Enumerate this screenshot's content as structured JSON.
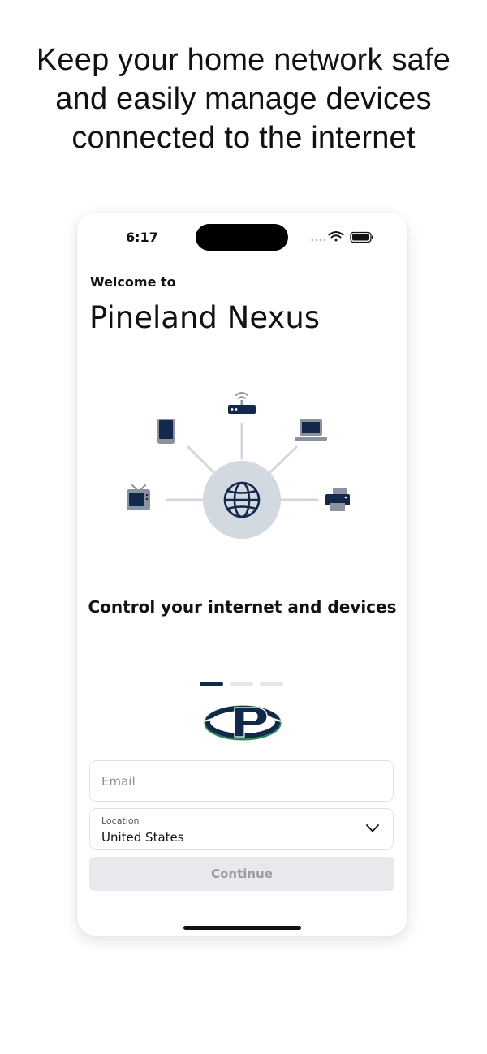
{
  "headline": {
    "line1": "Keep your home network safe",
    "line2": "and easily manage devices",
    "line3": "connected to the internet"
  },
  "status_bar": {
    "time": "6:17",
    "icons": [
      "signal-dots-icon",
      "wifi-icon",
      "battery-icon"
    ]
  },
  "welcome": {
    "prefix": "Welcome to",
    "app_name": "Pineland Nexus"
  },
  "illustration": {
    "center_icon": "globe-icon",
    "devices": [
      "router-icon",
      "tablet-icon",
      "laptop-icon",
      "tv-icon",
      "printer-icon"
    ]
  },
  "carousel": {
    "title": "Control your internet and devices",
    "page_count": 3,
    "active_index": 0
  },
  "logo": {
    "letter": "P"
  },
  "form": {
    "email_placeholder": "Email",
    "email_value": "",
    "location_label": "Location",
    "location_value": "United States",
    "continue_label": "Continue"
  },
  "colors": {
    "brand_navy": "#13294b",
    "icon_gray": "#8a939e",
    "line_gray": "#d3d6db",
    "globe_circle": "#d3d9e0",
    "logo_green": "#2e8b4f",
    "disabled_button": "#e8e9ec"
  }
}
